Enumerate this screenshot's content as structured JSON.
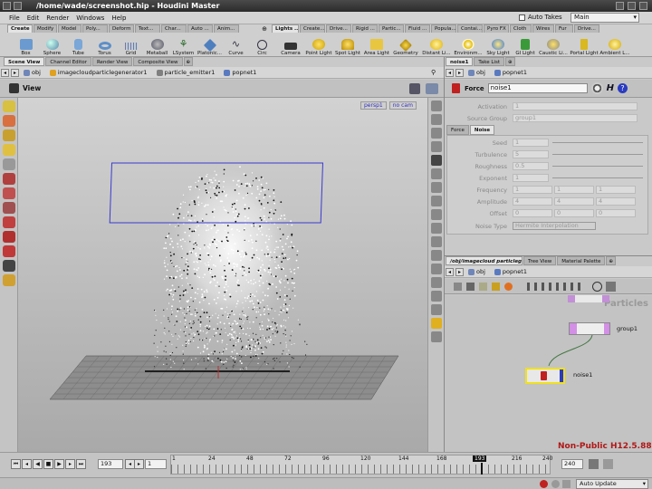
{
  "window": {
    "title": "/home/wade/screenshot.hip - Houdini Master"
  },
  "menubar": {
    "items": [
      "File",
      "Edit",
      "Render",
      "Windows",
      "Help"
    ],
    "auto_takes_label": "Auto Takes",
    "take_select": "Main"
  },
  "shelf": {
    "left_tabs": [
      "Create",
      "Modify",
      "Model",
      "Poly...",
      "Deform",
      "Text...",
      "Char...",
      "Auto ...",
      "Anim..."
    ],
    "left_tools": [
      "Box",
      "Sphere",
      "Tube",
      "Torus",
      "Grid",
      "Metaball",
      "LSystem",
      "Platonic...",
      "Curve",
      "Circ"
    ],
    "right_tabs": [
      "Lights ...",
      "Create...",
      "Drive...",
      "Rigid ...",
      "Partic...",
      "Fluid ...",
      "Popula...",
      "Contai...",
      "Pyro FX",
      "Cloth",
      "Wires",
      "Fur",
      "Drive..."
    ],
    "right_tools": [
      "Camera",
      "Point Light",
      "Spot Light",
      "Area Light",
      "Geometry",
      "Distant Li...",
      "Environm...",
      "Sky Light",
      "GI Light",
      "Caustic Li...",
      "Portal Light",
      "Ambient L..."
    ]
  },
  "left_pane": {
    "tabs": [
      "Scene View",
      "Channel Editor",
      "Render View",
      "Composite View"
    ],
    "path": [
      "obj",
      "imagecloudparticlegenerator1",
      "particle_emitter1",
      "popnet1"
    ],
    "view_label": "View",
    "camera_menu": "persp1",
    "cam_menu": "no cam"
  },
  "parm_pane": {
    "tabs": [
      "noise1",
      "Take List"
    ],
    "path": [
      "obj",
      "popnet1"
    ],
    "node_type": "Force",
    "node_name": "noise1",
    "activation": {
      "label": "Activation",
      "value": "1"
    },
    "source_group": {
      "label": "Source Group",
      "value": "group1"
    },
    "subtabs": [
      "Force",
      "Noise"
    ],
    "rows": [
      {
        "label": "Seed",
        "values": [
          "1"
        ]
      },
      {
        "label": "Turbulence",
        "values": [
          "5"
        ]
      },
      {
        "label": "Roughness",
        "values": [
          "0.5"
        ]
      },
      {
        "label": "Exponent",
        "values": [
          "1"
        ]
      },
      {
        "label": "Frequency",
        "values": [
          "1",
          "1",
          "1"
        ]
      },
      {
        "label": "Amplitude",
        "values": [
          "4",
          "4",
          "4"
        ]
      },
      {
        "label": "Offset",
        "values": [
          "0",
          "0",
          "0"
        ]
      }
    ],
    "noise_type": {
      "label": "Noise Type",
      "value": "Hermite Interpolation"
    }
  },
  "network_pane": {
    "tabs": [
      "/obj/imagecloud particleg...",
      "Tree View",
      "Material Palette"
    ],
    "path": [
      "obj",
      "popnet1"
    ],
    "context_label": "Particles",
    "nodes": [
      "group1",
      "noise1"
    ]
  },
  "timeline": {
    "current_frame": "193",
    "start_frame": "1",
    "end_frame": "240",
    "ticks": [
      "1",
      "24",
      "48",
      "72",
      "96",
      "120",
      "144",
      "168",
      "193",
      "216",
      "240"
    ],
    "watermark": "Non-Public H12.5.88"
  },
  "statusbar": {
    "update_mode": "Auto Update"
  },
  "colors": {
    "accent": "#2a3bbf",
    "watermark": "#b01818",
    "selected_node": "#f0e020"
  }
}
